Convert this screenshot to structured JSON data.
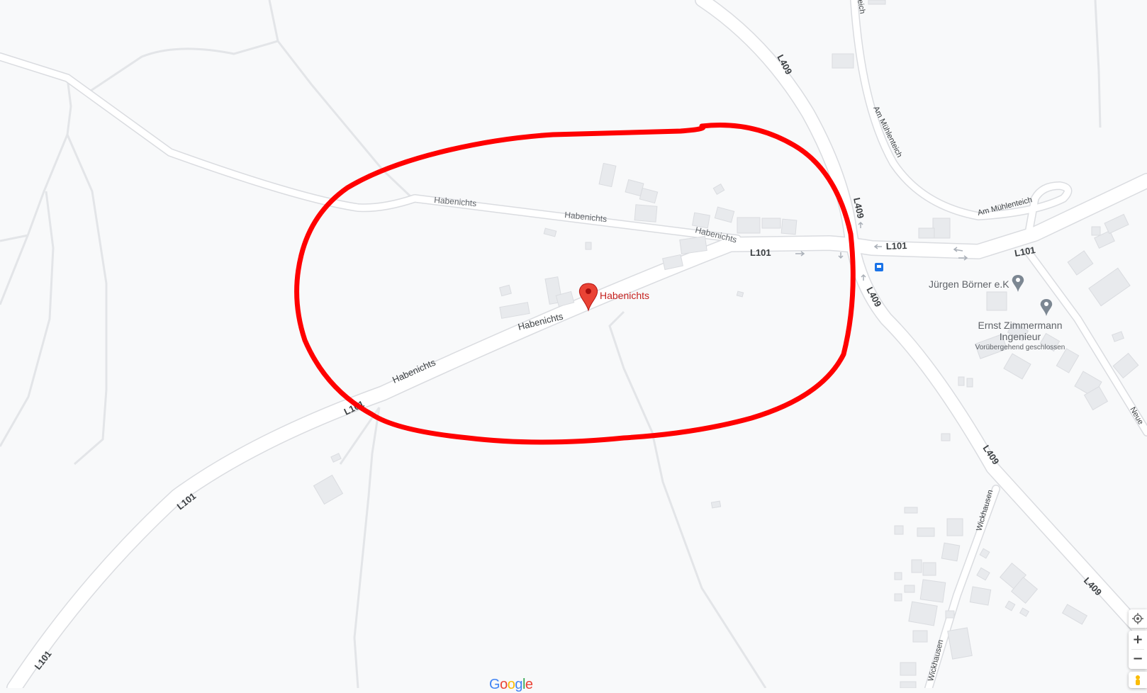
{
  "map": {
    "roads": {
      "habenichts_upper_1": "Habenichts",
      "habenichts_upper_2": "Habenichts",
      "habenichts_upper_3": "Habenichts",
      "habenichts_main_1": "Habenichts",
      "habenichts_main_2": "Habenichts",
      "l101_a": "L101",
      "l101_b": "L101",
      "l101_c": "L101",
      "l101_d": "L101",
      "l101_e": "L101",
      "l101_f": "L101",
      "l409_a": "L409",
      "l409_b": "L409",
      "l409_c": "L409",
      "l409_d": "L409",
      "l409_e": "L409",
      "muehlenteich_a": "Am Mühlenteich",
      "muehlenteich_b": "Am Mühlenteich",
      "muehlenteich_top": "eich",
      "wickhausen_a": "Wickhausen",
      "wickhausen_b": "Wickhausen",
      "neue_edge": "Neue"
    },
    "pois": {
      "habenichts": {
        "name": "Habenichts",
        "color": "#c5221f",
        "pin_color": "#ea4335"
      },
      "juergen": {
        "name": "Jürgen Börner e.K",
        "color": "#5f6368"
      },
      "ernst": {
        "name_line1": "Ernst Zimmermann",
        "name_line2": "Ingenieur",
        "status": "Vorübergehend geschlossen",
        "color": "#5f6368"
      }
    },
    "annotation": {
      "type": "hand-drawn circle",
      "color": "#ff0000"
    },
    "colors": {
      "background": "#f8f9fa",
      "road_fill": "#ffffff",
      "road_casing": "#dadce0",
      "building": "#e8eaed",
      "transit": "#1a73e8"
    }
  },
  "controls": {
    "my_location_icon": "my-location-icon",
    "zoom_in": "+",
    "zoom_out": "−",
    "pegman_icon": "pegman-icon"
  },
  "attribution": {
    "logo_letters": [
      "G",
      "o",
      "o",
      "g",
      "l",
      "e"
    ],
    "logo_colors": [
      "#4285f4",
      "#ea4335",
      "#fbbc05",
      "#4285f4",
      "#34a853",
      "#ea4335"
    ]
  }
}
